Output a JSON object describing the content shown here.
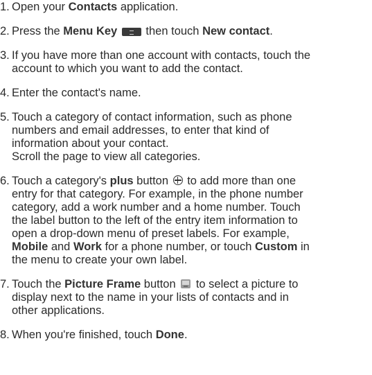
{
  "steps": [
    {
      "n": "1.",
      "lines": [
        [
          "Open your ",
          {
            "b": "Contacts"
          },
          " application."
        ]
      ]
    },
    {
      "n": "2.",
      "lines": [
        [
          "Press the ",
          {
            "b": "Menu Key"
          },
          " ",
          {
            "icon": "menu-key-icon"
          },
          " then touch ",
          {
            "b": "New contact"
          },
          "."
        ]
      ]
    },
    {
      "n": "3.",
      "lines": [
        [
          "If you have more than one account with contacts, touch the"
        ],
        [
          "account to which you want to add the contact."
        ]
      ]
    },
    {
      "n": "4.",
      "lines": [
        [
          "Enter the contact's name."
        ]
      ]
    },
    {
      "n": "5.",
      "lines": [
        [
          "Touch a category of contact information, such as phone"
        ],
        [
          "numbers and email addresses, to enter that kind of"
        ],
        [
          "information about your contact."
        ],
        [
          "Scroll the page to view all categories."
        ]
      ]
    },
    {
      "n": "6.",
      "lines": [
        [
          "Touch a category's ",
          {
            "b": "plus"
          },
          " button ",
          {
            "icon": "plus-circle-icon"
          },
          " to add more than one"
        ],
        [
          "entry for that category. For example, in the phone number"
        ],
        [
          "category, add a work number and a home number. Touch"
        ],
        [
          "the label button to the left of the entry item information to"
        ],
        [
          "open a drop-down menu of preset labels. For example,"
        ],
        [
          {
            "b": "Mobile"
          },
          " and ",
          {
            "b": "Work"
          },
          " for a phone number, or touch ",
          {
            "b": "Custom"
          },
          " in"
        ],
        [
          "the menu to create your own label."
        ]
      ]
    },
    {
      "n": "7.",
      "lines": [
        [
          "Touch the ",
          {
            "b": "Picture Frame"
          },
          " button ",
          {
            "icon": "picture-frame-icon"
          },
          " to select a picture to"
        ],
        [
          "display next to the name in your lists of contacts and in"
        ],
        [
          "other applications."
        ]
      ]
    },
    {
      "n": "8.",
      "lines": [
        [
          "When you're finished, touch ",
          {
            "b": "Done"
          },
          "."
        ]
      ]
    }
  ]
}
